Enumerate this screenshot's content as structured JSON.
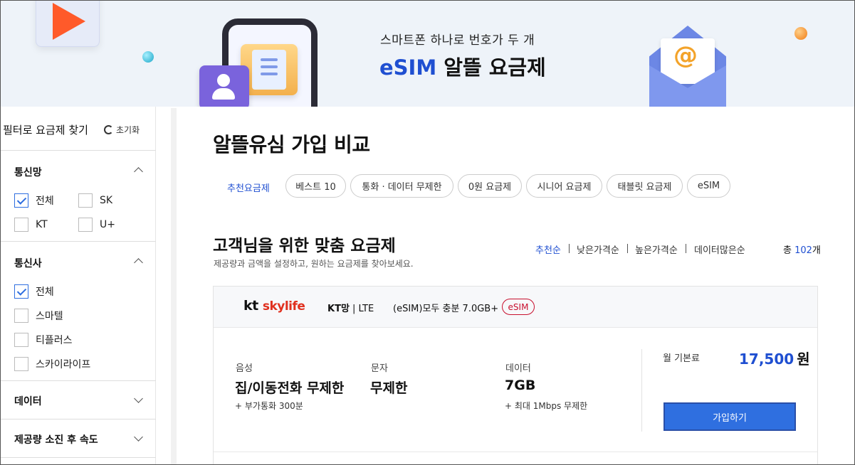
{
  "banner": {
    "subtitle": "스마트폰 하나로 번호가 두 개",
    "title_accent": "eSIM",
    "title_rest": " 알뜰 요금제",
    "at_symbol": "@"
  },
  "sidebar": {
    "header_title": "필터로 요금제 찾기",
    "reset_label": "초기화",
    "network": {
      "title": "통신망",
      "options": [
        {
          "label": "전체",
          "checked": true
        },
        {
          "label": "SK",
          "checked": false
        },
        {
          "label": "KT",
          "checked": false
        },
        {
          "label": "U+",
          "checked": false
        }
      ]
    },
    "carrier": {
      "title": "통신사",
      "options": [
        {
          "label": "전체",
          "checked": true
        },
        {
          "label": "스마텔",
          "checked": false
        },
        {
          "label": "티플러스",
          "checked": false
        },
        {
          "label": "스카이라이프",
          "checked": false
        }
      ]
    },
    "data_section": {
      "title": "데이터"
    },
    "speed_section": {
      "title": "제공량 소진 후 속도"
    }
  },
  "main": {
    "page_title": "알뜰유심 가입 비교",
    "tabs": [
      "추천요금제",
      "베스트 10",
      "통화 · 데이터 무제한",
      "0원 요금제",
      "시니어 요금제",
      "태블릿 요금제",
      "eSIM"
    ],
    "section_title": "고객님을 위한 맞춤 요금제",
    "section_desc": "제공량과 금액을 설정하고, 원하는 요금제를 찾아보세요.",
    "sort_options": [
      "추천순",
      "낮은가격순",
      "높은가격순",
      "데이터많은순"
    ],
    "total_prefix": "총 ",
    "total_count": "102",
    "total_suffix": "개"
  },
  "plan": {
    "logo_kt": "kt",
    "logo_sky": "skylife",
    "network_bold": "KT망",
    "network_rest": " | LTE",
    "name": "(eSIM)모두 충분 7.0GB+",
    "badge": "eSIM",
    "voice_label": "음성",
    "voice_value": "집/이동전화 무제한",
    "voice_note": "+ 부가통화 300분",
    "sms_label": "문자",
    "sms_value": "무제한",
    "data_label": "데이터",
    "data_value": "7GB",
    "data_note": "+ 최대 1Mbps 무제한",
    "price_label": "월 기본료",
    "price_value": "17,500",
    "price_unit": "원",
    "join_label": "가입하기"
  },
  "colors": {
    "accent_blue": "#1f4fd1",
    "button_blue": "#2f6fe0",
    "esim_red": "#c8102e",
    "banner_bg": "#eef3f9"
  }
}
